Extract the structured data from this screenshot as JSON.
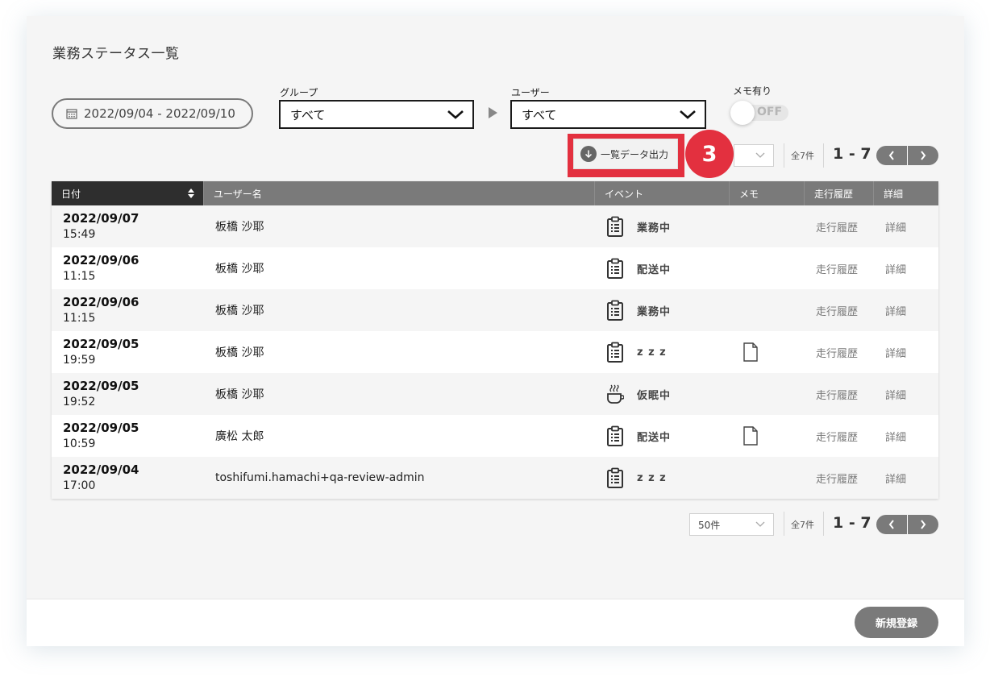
{
  "page": {
    "title": "業務ステータス一覧"
  },
  "filters": {
    "date_range": "2022/09/04 - 2022/09/10",
    "group_label": "グループ",
    "group_value": "すべて",
    "user_label": "ユーザー",
    "user_value": "すべて",
    "memo_label": "メモ有り",
    "memo_toggle": "OFF"
  },
  "toolbar": {
    "export_label": "一覧データ出力",
    "annotation_number": "3",
    "total": "全7件",
    "range": "1 - 7"
  },
  "table": {
    "headers": {
      "date": "日付",
      "user": "ユーザー名",
      "event": "イベント",
      "memo": "メモ",
      "log": "走行履歴",
      "detail": "詳細"
    },
    "rows": [
      {
        "date": "2022/09/07",
        "time": "15:49",
        "user": "板橋 沙耶",
        "event_icon": "clipboard-icon",
        "event": "業務中",
        "memo": false,
        "log": "走行履歴",
        "detail": "詳細"
      },
      {
        "date": "2022/09/06",
        "time": "11:15",
        "user": "板橋 沙耶",
        "event_icon": "clipboard-icon",
        "event": "配送中",
        "memo": false,
        "log": "走行履歴",
        "detail": "詳細"
      },
      {
        "date": "2022/09/06",
        "time": "11:15",
        "user": "板橋 沙耶",
        "event_icon": "clipboard-icon",
        "event": "業務中",
        "memo": false,
        "log": "走行履歴",
        "detail": "詳細"
      },
      {
        "date": "2022/09/05",
        "time": "19:59",
        "user": "板橋 沙耶",
        "event_icon": "clipboard-icon",
        "event": "z z z",
        "memo": true,
        "log": "走行履歴",
        "detail": "詳細"
      },
      {
        "date": "2022/09/05",
        "time": "19:52",
        "user": "板橋 沙耶",
        "event_icon": "coffee-cup-icon",
        "event": "仮眠中",
        "memo": false,
        "log": "走行履歴",
        "detail": "詳細"
      },
      {
        "date": "2022/09/05",
        "time": "10:59",
        "user": "廣松 太郎",
        "event_icon": "clipboard-icon",
        "event": "配送中",
        "memo": true,
        "log": "走行履歴",
        "detail": "詳細"
      },
      {
        "date": "2022/09/04",
        "time": "17:00",
        "user": "toshifumi.hamachi+qa-review-admin",
        "event_icon": "clipboard-icon",
        "event": "z z z",
        "memo": false,
        "log": "走行履歴",
        "detail": "詳細"
      }
    ]
  },
  "bottom_pager": {
    "per_page": "50件",
    "total": "全7件",
    "range": "1 - 7"
  },
  "footer": {
    "register_label": "新規登録"
  },
  "colors": {
    "accent_red": "#e3303f",
    "header_gray": "#7a7a7a",
    "header_dark": "#2e2e2e"
  }
}
